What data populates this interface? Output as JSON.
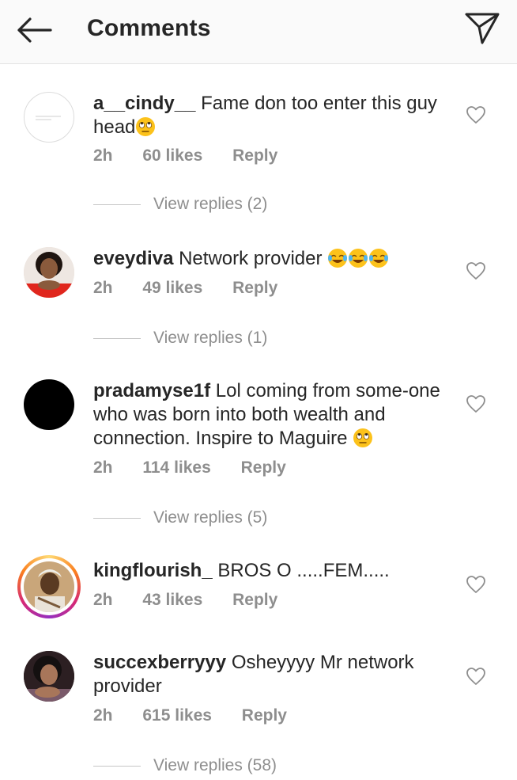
{
  "header": {
    "title": "Comments",
    "back_icon": "back-arrow-icon",
    "share_icon": "direct-share-icon"
  },
  "colors": {
    "text": "#262626",
    "meta": "#8e8e8e",
    "story_ring": "#d6249f"
  },
  "comments": [
    {
      "username": "a__cindy__",
      "text": "Fame don too enter this guy head",
      "emojis": [
        "face-with-rolling-eyes"
      ],
      "time": "2h",
      "likes": "60 likes",
      "reply": "Reply",
      "view_replies": "View replies (2)"
    },
    {
      "username": "eveydiva",
      "text": "Network provider",
      "emojis": [
        "face-with-tears-of-joy",
        "face-with-tears-of-joy",
        "face-with-tears-of-joy"
      ],
      "time": "2h",
      "likes": "49 likes",
      "reply": "Reply",
      "view_replies": "View replies (1)"
    },
    {
      "username": "pradamyse1f",
      "text": "Lol coming from some-one who was born into both wealth and connection. Inspire to Maguire",
      "emojis": [
        "face-with-rolling-eyes"
      ],
      "time": "2h",
      "likes": "114 likes",
      "reply": "Reply",
      "view_replies": "View replies (5)"
    },
    {
      "username": "kingflourish_",
      "text": "BROS O .....FEM.....",
      "time": "2h",
      "likes": "43 likes",
      "reply": "Reply"
    },
    {
      "username": "succexberryyy",
      "text": "Osheyyyy Mr network provider",
      "time": "2h",
      "likes": "615 likes",
      "reply": "Reply",
      "view_replies": "View replies (58)"
    }
  ]
}
